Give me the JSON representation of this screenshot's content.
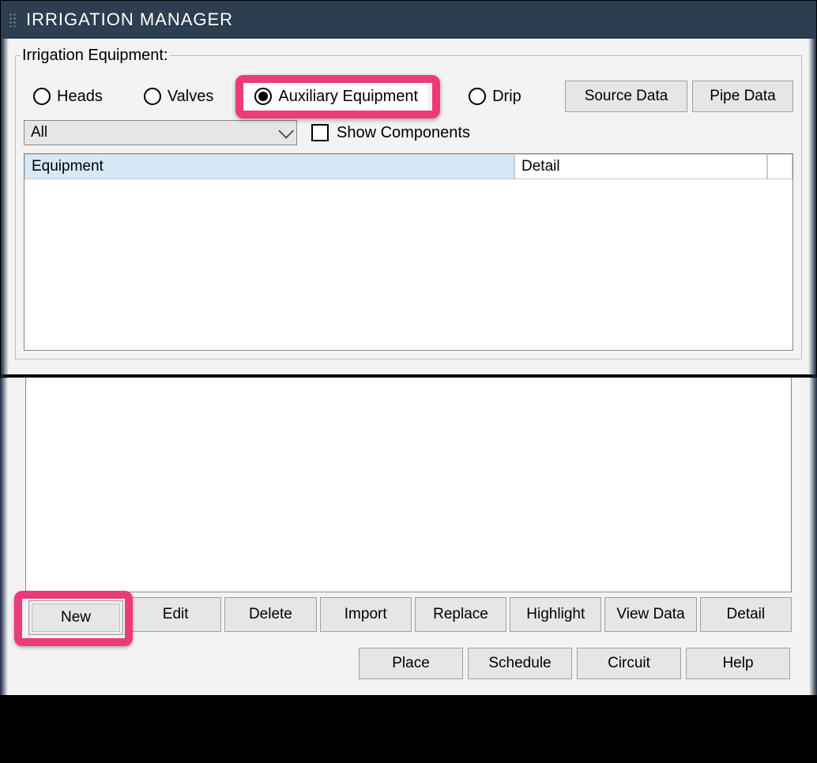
{
  "title": "IRRIGATION MANAGER",
  "group_label": "Irrigation Equipment:",
  "radios": {
    "heads": "Heads",
    "valves": "Valves",
    "aux": "Auxiliary Equipment",
    "drip": "Drip",
    "selected": "aux"
  },
  "top_buttons": {
    "source": "Source Data",
    "pipe": "Pipe Data"
  },
  "filter": {
    "selected": "All"
  },
  "show_components": "Show Components",
  "table": {
    "col_equipment": "Equipment",
    "col_detail": "Detail"
  },
  "mid_buttons": {
    "new": "New",
    "edit": "Edit",
    "delete": "Delete",
    "import": "Import",
    "replace": "Replace",
    "highlight": "Highlight",
    "viewdata": "View Data",
    "detail": "Detail"
  },
  "bottom_buttons": {
    "place": "Place",
    "schedule": "Schedule",
    "circuit": "Circuit",
    "help": "Help"
  },
  "highlight_color": "#ec3b7a"
}
